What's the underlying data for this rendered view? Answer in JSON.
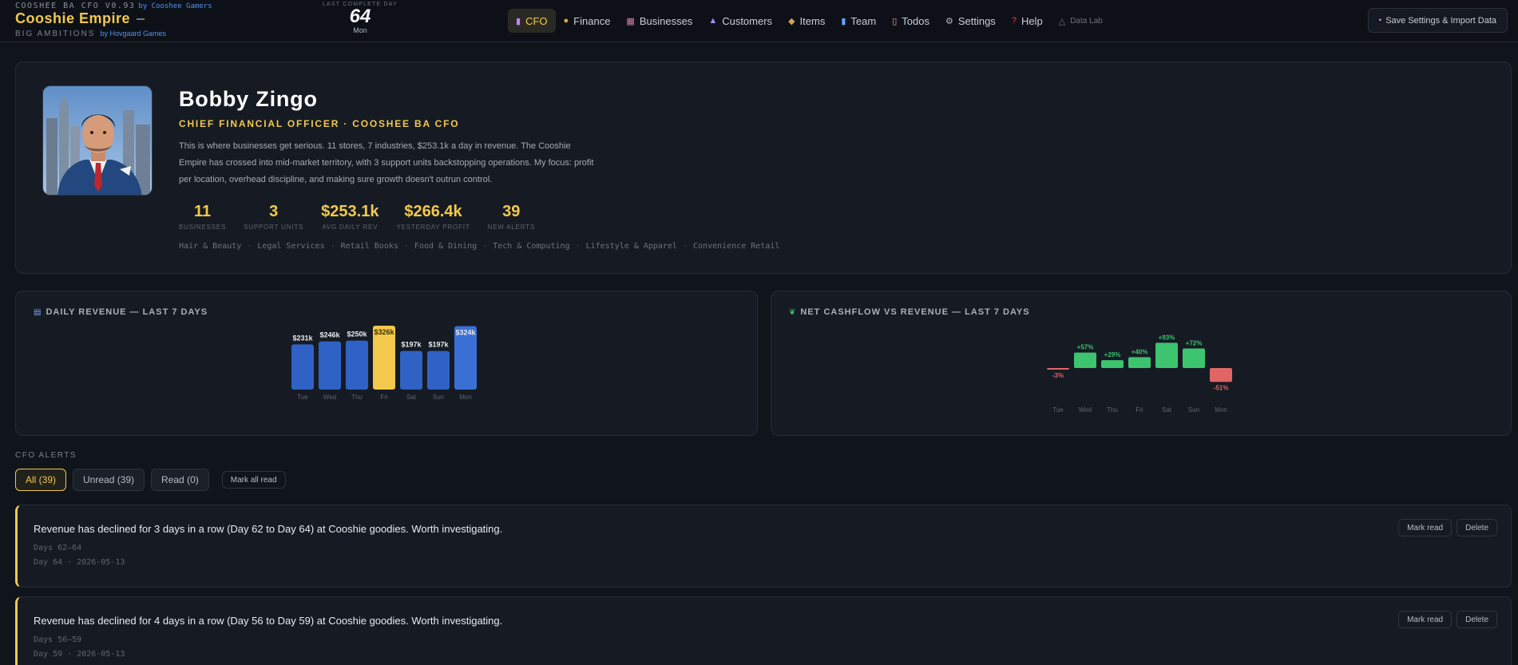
{
  "header": {
    "app_title": "COOSHEE BA CFO V0.93",
    "app_by": "by Cooshee Gamers",
    "brand": "Cooshie Empire",
    "tagline": "BIG AMBITIONS",
    "tagline_by": "by Hovgaard Games",
    "day_label": "LAST COMPLETE DAY",
    "day_number": "64",
    "day_name": "Mon",
    "nav": [
      {
        "label": "CFO",
        "icon": "ledger-icon"
      },
      {
        "label": "Finance",
        "icon": "money-bag-icon"
      },
      {
        "label": "Businesses",
        "icon": "store-icon"
      },
      {
        "label": "Customers",
        "icon": "people-icon"
      },
      {
        "label": "Items",
        "icon": "package-icon"
      },
      {
        "label": "Team",
        "icon": "person-icon"
      },
      {
        "label": "Todos",
        "icon": "clipboard-icon"
      },
      {
        "label": "Settings",
        "icon": "gear-icon"
      },
      {
        "label": "Help",
        "icon": "question-icon"
      },
      {
        "label": "Data Lab",
        "icon": "flask-icon"
      }
    ],
    "save_label": "Save Settings & Import Data"
  },
  "profile": {
    "name": "Bobby Zingo",
    "role": "CHIEF FINANCIAL OFFICER · COOSHEE BA CFO",
    "description": "This is where businesses get serious. 11 stores, 7 industries, $253.1k a day in revenue. The Cooshie Empire has crossed into mid-market territory, with 3 support units backstopping operations. My focus: profit per location, overhead discipline, and making sure growth doesn't outrun control.",
    "stats": [
      {
        "value": "11",
        "label": "BUSINESSES"
      },
      {
        "value": "3",
        "label": "SUPPORT UNITS"
      },
      {
        "value": "$253.1k",
        "label": "AVG DAILY REV"
      },
      {
        "value": "$266.4k",
        "label": "YESTERDAY PROFIT"
      },
      {
        "value": "39",
        "label": "NEW ALERTS"
      }
    ],
    "industries": [
      "Hair & Beauty",
      "Legal Services",
      "Retail Books",
      "Food & Dining",
      "Tech & Computing",
      "Lifestyle & Apparel",
      "Convenience Retail"
    ]
  },
  "chart_data": [
    {
      "type": "bar",
      "title": "DAILY REVENUE — LAST 7 DAYS",
      "icon": "chart-icon",
      "categories": [
        "Tue",
        "Wed",
        "Thu",
        "Fri",
        "Sat",
        "Sun",
        "Mon"
      ],
      "values": [
        231,
        246,
        250,
        326,
        197,
        197,
        324
      ],
      "labels": [
        "$231k",
        "$246k",
        "$250k",
        "$326k",
        "$197k",
        "$197k",
        "$324k"
      ],
      "highlight_index": 3,
      "last_index": 6,
      "colors": {
        "default": "#2f62c4",
        "highlight": "#f2c94c",
        "last": "#3a6fd6"
      }
    },
    {
      "type": "bar",
      "title": "NET CASHFLOW VS REVENUE — LAST 7 DAYS",
      "icon": "leaf-icon",
      "categories": [
        "Tue",
        "Wed",
        "Thu",
        "Fri",
        "Sat",
        "Sun",
        "Mon"
      ],
      "values": [
        -3,
        57,
        29,
        40,
        93,
        72,
        -51
      ],
      "labels": [
        "-3%",
        "+57%",
        "+29%",
        "+40%",
        "+93%",
        "+72%",
        "-51%"
      ],
      "colors": {
        "positive": "#3cc46f",
        "negative": "#e06666"
      }
    }
  ],
  "alerts": {
    "heading": "CFO ALERTS",
    "filters": [
      {
        "label": "All (39)",
        "active": true
      },
      {
        "label": "Unread (39)",
        "active": false
      },
      {
        "label": "Read (0)",
        "active": false
      }
    ],
    "mark_all_label": "Mark all read",
    "mark_read_label": "Mark read",
    "delete_label": "Delete",
    "items": [
      {
        "message": "Revenue has declined for 3 days in a row (Day 62 to Day 64) at Cooshie goodies. Worth investigating.",
        "range": "Days 62–64",
        "stamp": "Day 64 · 2026-05-13"
      },
      {
        "message": "Revenue has declined for 4 days in a row (Day 56 to Day 59) at Cooshie goodies. Worth investigating.",
        "range": "Days 56–59",
        "stamp": "Day 59 · 2026-05-13"
      }
    ]
  }
}
